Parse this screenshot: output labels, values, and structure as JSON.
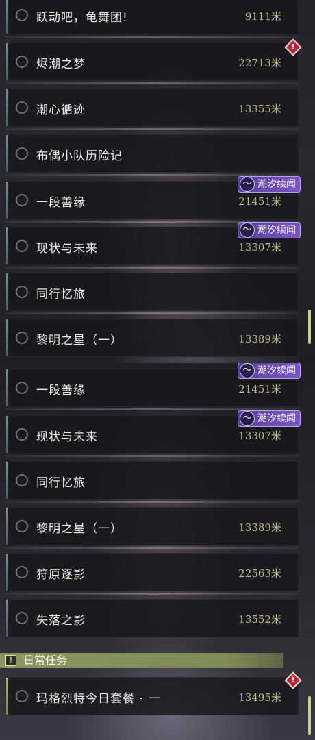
{
  "top_list": [
    {
      "title": "跃动吧，龟舞团!",
      "distance": "9111米"
    },
    {
      "title": "烬潮之梦",
      "distance": "22713米",
      "alert": "!"
    },
    {
      "title": "潮心循迹",
      "distance": "13355米"
    },
    {
      "title": "布偶小队历险记",
      "distance": ""
    },
    {
      "title": "一段善缘",
      "distance": "21451米",
      "badge": "潮汐续闻"
    },
    {
      "title": "现状与未来",
      "distance": "13307米",
      "badge": "潮汐续闻"
    },
    {
      "title": "同行忆旅",
      "distance": ""
    },
    {
      "title": "黎明之星（一）",
      "distance": "13389米"
    }
  ],
  "bottom_list": [
    {
      "title": "一段善缘",
      "distance": "21451米",
      "badge": "潮汐续闻"
    },
    {
      "title": "现状与未来",
      "distance": "13307米",
      "badge": "潮汐续闻"
    },
    {
      "title": "同行忆旅",
      "distance": ""
    },
    {
      "title": "黎明之星（一）",
      "distance": "13389米"
    },
    {
      "title": "狩原逐影",
      "distance": "22563米"
    },
    {
      "title": "失落之影",
      "distance": "13552米"
    }
  ],
  "daily": {
    "header": "日常任务",
    "header_icon": "!",
    "items": [
      {
        "title": "玛格烈特今日套餐 · 一",
        "distance": "13495米",
        "alert": "!"
      }
    ]
  },
  "colors": {
    "distance": "#c8ba8a",
    "badge": "#7a55c4",
    "alert": "#b12a3c",
    "daily_header": "#8a9660"
  }
}
